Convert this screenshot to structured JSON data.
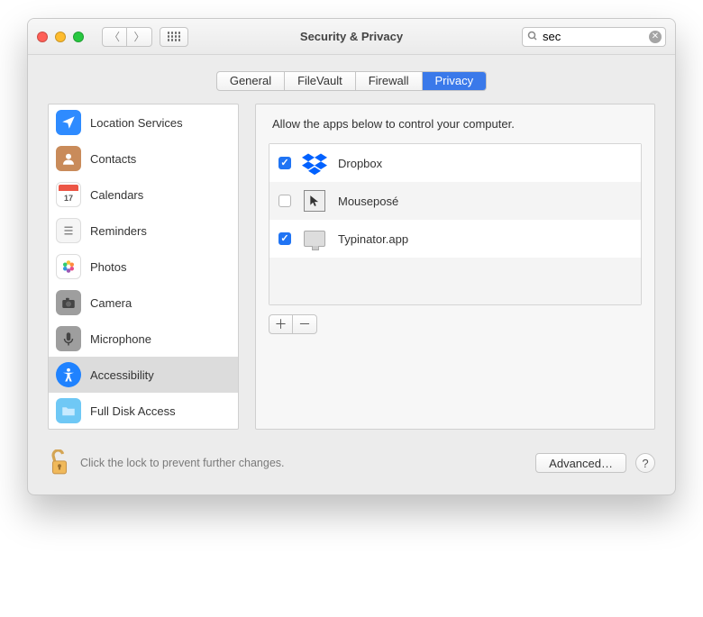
{
  "window_title": "Security & Privacy",
  "search": {
    "value": "sec"
  },
  "tabs": {
    "items": [
      {
        "label": "General"
      },
      {
        "label": "FileVault"
      },
      {
        "label": "Firewall"
      },
      {
        "label": "Privacy"
      }
    ],
    "active_index": 3
  },
  "sidebar": {
    "items": [
      {
        "label": "Location Services",
        "icon": "location"
      },
      {
        "label": "Contacts",
        "icon": "contacts"
      },
      {
        "label": "Calendars",
        "icon": "calendar"
      },
      {
        "label": "Reminders",
        "icon": "reminders"
      },
      {
        "label": "Photos",
        "icon": "photos"
      },
      {
        "label": "Camera",
        "icon": "camera"
      },
      {
        "label": "Microphone",
        "icon": "microphone"
      },
      {
        "label": "Accessibility",
        "icon": "accessibility"
      },
      {
        "label": "Full Disk Access",
        "icon": "folder"
      }
    ],
    "selected_index": 7
  },
  "panel": {
    "description": "Allow the apps below to control your computer.",
    "apps": [
      {
        "name": "Dropbox",
        "checked": true,
        "icon": "dropbox"
      },
      {
        "name": "Mouseposé",
        "checked": false,
        "icon": "mousepose"
      },
      {
        "name": "Typinator.app",
        "checked": true,
        "icon": "typinator"
      }
    ]
  },
  "footer": {
    "lock_text": "Click the lock to prevent further changes.",
    "advanced_label": "Advanced…"
  }
}
